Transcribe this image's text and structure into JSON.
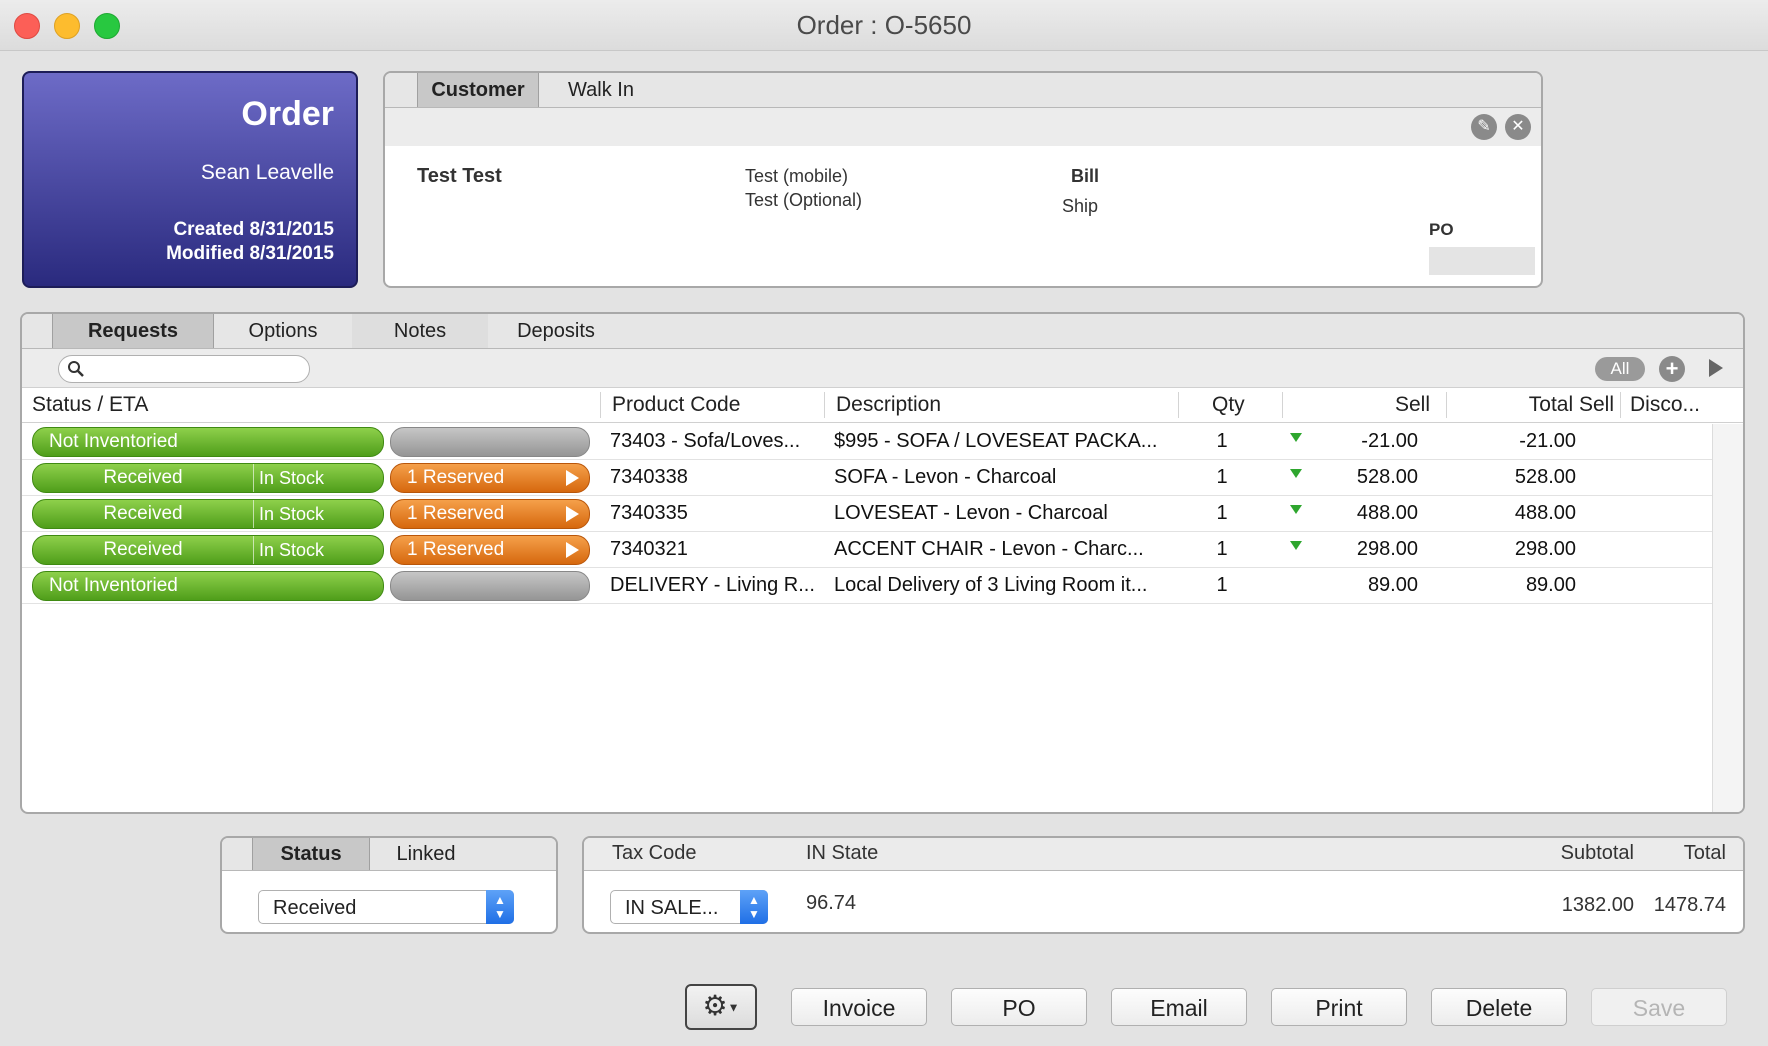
{
  "window": {
    "title": "Order : O-5650"
  },
  "order_card": {
    "heading": "Order",
    "salesperson": "Sean Leavelle",
    "created": "Created 8/31/2015",
    "modified": "Modified 8/31/2015"
  },
  "customer_panel": {
    "tabs": [
      "Customer",
      "Walk In"
    ],
    "name": "Test Test",
    "phone_mobile": "Test (mobile)",
    "phone_optional": "Test (Optional)",
    "bill_label": "Bill",
    "ship_label": "Ship",
    "po_label": "PO",
    "po_value": ""
  },
  "requests_panel": {
    "tabs": [
      "Requests",
      "Options",
      "Notes",
      "Deposits"
    ],
    "search": {
      "value": "",
      "placeholder": ""
    },
    "filter_label": "All",
    "columns": [
      "Status / ETA",
      "Product Code",
      "Description",
      "Qty",
      "Sell",
      "Total Sell",
      "Disco..."
    ],
    "rows": [
      {
        "status": "Not Inventoried",
        "stock": "",
        "reserve": "",
        "code": "73403 - Sofa/Loves...",
        "description": "$995 - SOFA / LOVESEAT PACKA...",
        "qty": "1",
        "flag": true,
        "sell": "-21.00",
        "total": "-21.00"
      },
      {
        "status": "Received",
        "stock": "In Stock",
        "reserve": "1 Reserved",
        "code": "7340338",
        "description": "SOFA -  Levon - Charcoal",
        "qty": "1",
        "flag": true,
        "sell": "528.00",
        "total": "528.00"
      },
      {
        "status": "Received",
        "stock": "In Stock",
        "reserve": "1 Reserved",
        "code": "7340335",
        "description": "LOVESEAT -  Levon - Charcoal",
        "qty": "1",
        "flag": true,
        "sell": "488.00",
        "total": "488.00"
      },
      {
        "status": "Received",
        "stock": "In Stock",
        "reserve": "1 Reserved",
        "code": "7340321",
        "description": "ACCENT CHAIR -  Levon - Charc...",
        "qty": "1",
        "flag": true,
        "sell": "298.00",
        "total": "298.00"
      },
      {
        "status": "Not Inventoried",
        "stock": "",
        "reserve": "",
        "code": "DELIVERY - Living R...",
        "description": "Local Delivery of 3 Living Room it...",
        "qty": "1",
        "flag": false,
        "sell": "89.00",
        "total": "89.00"
      }
    ]
  },
  "status_panel": {
    "tabs": [
      "Status",
      "Linked"
    ],
    "selected": "Received"
  },
  "tax_panel": {
    "tax_code_label": "Tax Code",
    "tax_code_value": "IN SALE...",
    "state_label": "IN State",
    "state_value": "96.74",
    "subtotal_label": "Subtotal",
    "subtotal_value": "1382.00",
    "total_label": "Total",
    "total_value": "1478.74"
  },
  "buttons": {
    "invoice": "Invoice",
    "po": "PO",
    "email": "Email",
    "print": "Print",
    "delete": "Delete",
    "save": "Save"
  },
  "colors": {
    "order_card": "#3b3a96",
    "status_green": "#5fae24",
    "reserved_orange": "#e57a1f",
    "stepper_blue": "#2b7cf0"
  }
}
